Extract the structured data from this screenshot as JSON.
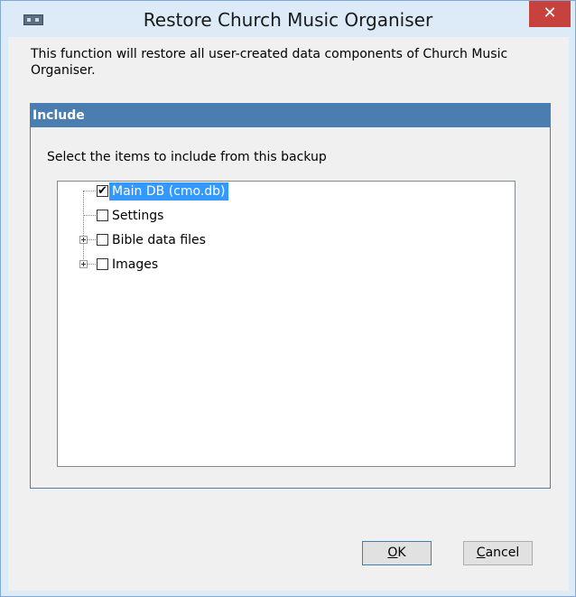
{
  "window": {
    "title": "Restore Church Music Organiser",
    "close_glyph": "✕",
    "app_icon": "tape-icon"
  },
  "description": "This function will restore all user-created data components of Church Music Organiser.",
  "include": {
    "header": "Include",
    "prompt": "Select the items to include from this backup",
    "items": [
      {
        "label": "Main DB (cmo.db)",
        "checked": true,
        "selected": true,
        "expandable": false
      },
      {
        "label": "Settings",
        "checked": false,
        "selected": false,
        "expandable": false
      },
      {
        "label": "Bible data files",
        "checked": false,
        "selected": false,
        "expandable": true
      },
      {
        "label": "Images",
        "checked": false,
        "selected": false,
        "expandable": true
      }
    ]
  },
  "buttons": {
    "ok": {
      "mnemonic": "O",
      "rest": "K"
    },
    "cancel": {
      "mnemonic": "C",
      "rest": "ancel"
    }
  },
  "colors": {
    "header_bg": "#4a7eb0",
    "selection_bg": "#3399ff",
    "close_bg": "#c7413d"
  }
}
